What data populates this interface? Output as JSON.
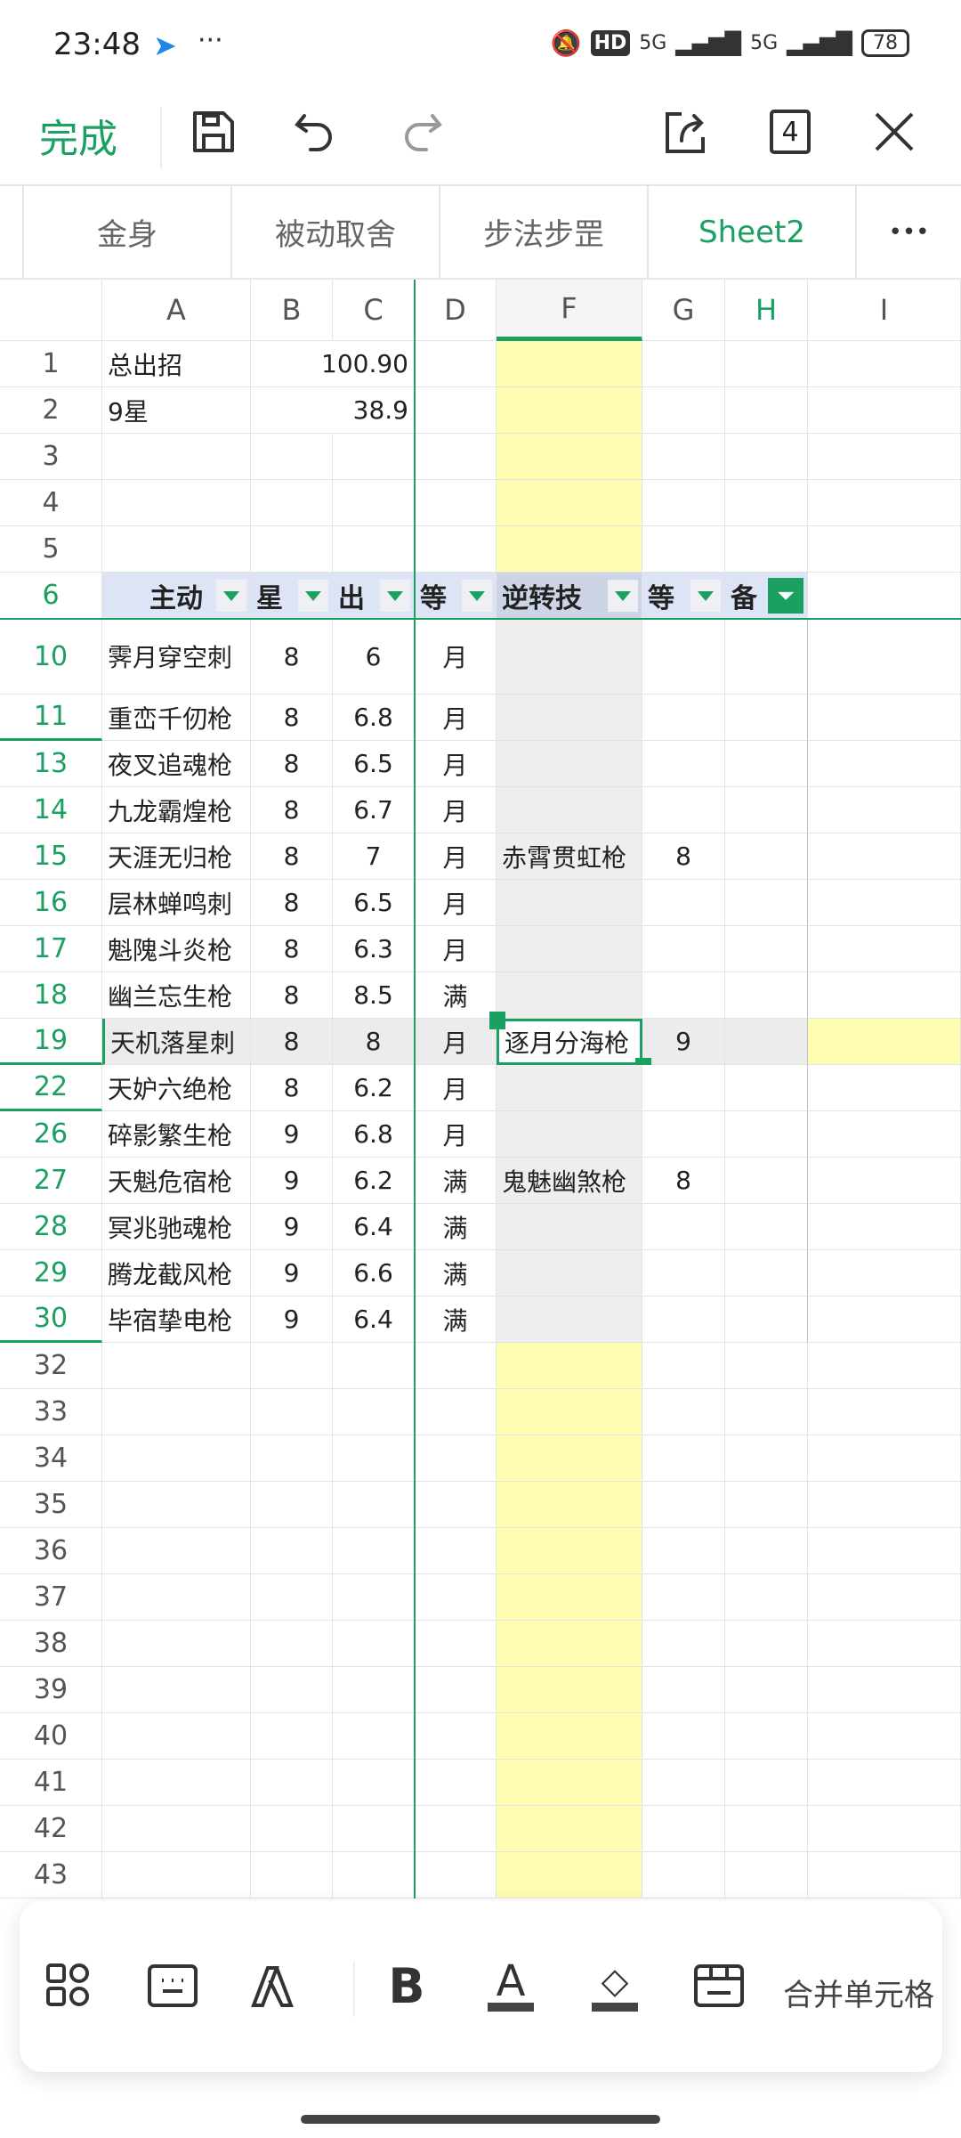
{
  "status_bar": {
    "time": "23:48",
    "more": "···",
    "network1": "5G",
    "network2": "5G",
    "hd": "HD",
    "battery": "78"
  },
  "toolbar": {
    "done_label": "完成",
    "window_count": "4"
  },
  "sheet_tabs": [
    {
      "label": "金身",
      "active": false
    },
    {
      "label": "被动取舍",
      "active": false
    },
    {
      "label": "步法步罡",
      "active": false
    },
    {
      "label": "Sheet2",
      "active": true
    }
  ],
  "more_tabs": "•••",
  "columns": [
    "A",
    "B",
    "C",
    "D",
    "F",
    "G",
    "H",
    "I"
  ],
  "top_rows": [
    {
      "row": "1",
      "A": "总出招",
      "BC": "100.90"
    },
    {
      "row": "2",
      "A": "9星",
      "BC": "38.9"
    },
    {
      "row": "3"
    },
    {
      "row": "4"
    },
    {
      "row": "5"
    }
  ],
  "header_row": {
    "row": "6",
    "cells": [
      "主动",
      "星",
      "出",
      "等",
      "逆转技",
      "等",
      "备"
    ]
  },
  "table_rows": [
    {
      "row": "10",
      "A": "霁月穿空刺",
      "B": "8",
      "C": "6",
      "D": "月",
      "F": "",
      "G": ""
    },
    {
      "row": "11",
      "A": "重峦千仞枪",
      "B": "8",
      "C": "6.8",
      "D": "月",
      "F": "",
      "G": ""
    },
    {
      "row": "13",
      "A": "夜叉追魂枪",
      "B": "8",
      "C": "6.5",
      "D": "月",
      "F": "",
      "G": ""
    },
    {
      "row": "14",
      "A": "九龙霸煌枪",
      "B": "8",
      "C": "6.7",
      "D": "月",
      "F": "",
      "G": ""
    },
    {
      "row": "15",
      "A": "天涯无归枪",
      "B": "8",
      "C": "7",
      "D": "月",
      "F": "赤霄贯虹枪",
      "G": "8"
    },
    {
      "row": "16",
      "A": "层林蝉鸣刺",
      "B": "8",
      "C": "6.5",
      "D": "月",
      "F": "",
      "G": ""
    },
    {
      "row": "17",
      "A": "魁隗斗炎枪",
      "B": "8",
      "C": "6.3",
      "D": "月",
      "F": "",
      "G": ""
    },
    {
      "row": "18",
      "A": "幽兰忘生枪",
      "B": "8",
      "C": "8.5",
      "D": "满",
      "F": "",
      "G": ""
    },
    {
      "row": "19",
      "A": "天机落星刺",
      "B": "8",
      "C": "8",
      "D": "月",
      "F": "逐月分海枪",
      "G": "9"
    },
    {
      "row": "22",
      "A": "天妒六绝枪",
      "B": "8",
      "C": "6.2",
      "D": "月",
      "F": "",
      "G": ""
    },
    {
      "row": "26",
      "A": "碎影繁生枪",
      "B": "9",
      "C": "6.8",
      "D": "月",
      "F": "",
      "G": ""
    },
    {
      "row": "27",
      "A": "天魁危宿枪",
      "B": "9",
      "C": "6.2",
      "D": "满",
      "F": "鬼魅幽煞枪",
      "G": "8"
    },
    {
      "row": "28",
      "A": "冥兆驰魂枪",
      "B": "9",
      "C": "6.4",
      "D": "满",
      "F": "",
      "G": ""
    },
    {
      "row": "29",
      "A": "腾龙截风枪",
      "B": "9",
      "C": "6.6",
      "D": "满",
      "F": "",
      "G": ""
    },
    {
      "row": "30",
      "A": "毕宿挚电枪",
      "B": "9",
      "C": "6.4",
      "D": "满",
      "F": "",
      "G": ""
    }
  ],
  "empty_rows": [
    "32",
    "33",
    "34",
    "35",
    "36",
    "37",
    "38",
    "39",
    "40",
    "41",
    "42",
    "43"
  ],
  "selected_cell": "F19",
  "bottom_toolbar": {
    "merge_label": "合并单元格"
  },
  "colors": {
    "accent": "#1aa060",
    "yellow": "#fffdb0",
    "header_blue": "#dde4f6"
  }
}
